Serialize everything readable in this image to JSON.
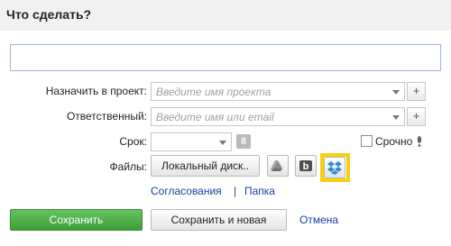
{
  "header": {
    "title": "Что сделать?"
  },
  "task": {
    "value": ""
  },
  "project": {
    "label": "Назначить в проект:",
    "placeholder": "Введите имя проекта"
  },
  "responsible": {
    "label": "Ответственный:",
    "placeholder": "Введите имя или email"
  },
  "deadline": {
    "label": "Срок:",
    "value": "",
    "calendar_glyph": "8",
    "urgent_label": "Срочно",
    "urgent_checked": false
  },
  "files": {
    "label": "Файлы:",
    "local_button": "Локальный диск..",
    "services": [
      "google-drive-icon",
      "box-icon",
      "dropbox-icon"
    ],
    "highlight_color": "#f7d00d"
  },
  "links": {
    "approvals": "Согласования",
    "separator": "|",
    "folder": "Папка"
  },
  "actions": {
    "save": "Сохранить",
    "save_new": "Сохранить и новая",
    "cancel": "Отмена"
  },
  "colors": {
    "save_button": "#4caf50",
    "link": "#1a3c9c",
    "input_border": "#9db8d8",
    "header_bg": "#f1f1f1"
  }
}
